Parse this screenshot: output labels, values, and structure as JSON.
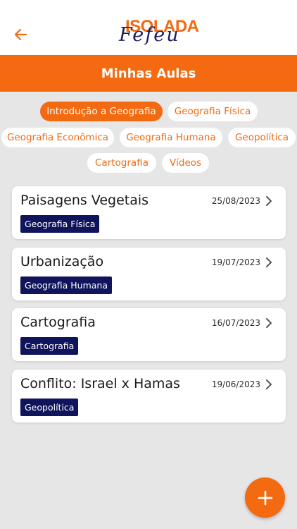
{
  "app": {
    "logo_top": "ISOLADA",
    "logo_script": "Fefeu"
  },
  "header": {
    "title": "Minhas Aulas"
  },
  "filters": [
    {
      "label": "Introdução a Geografia",
      "active": true
    },
    {
      "label": "Geografia Física",
      "active": false
    },
    {
      "label": "Geografia Econômica",
      "active": false
    },
    {
      "label": "Geografia Humana",
      "active": false
    },
    {
      "label": "Geopolítica",
      "active": false
    },
    {
      "label": "Cartografia",
      "active": false
    },
    {
      "label": "Vídeos",
      "active": false
    }
  ],
  "lessons": [
    {
      "title": "Paisagens Vegetais",
      "date": "25/08/2023",
      "tag": "Geografia Física"
    },
    {
      "title": "Urbanização",
      "date": "19/07/2023",
      "tag": "Geografia Humana"
    },
    {
      "title": "Cartografia",
      "date": "16/07/2023",
      "tag": "Cartografia"
    },
    {
      "title": "Conflito: Israel x Hamas",
      "date": "19/06/2023",
      "tag": "Geopolítica"
    }
  ],
  "icons": {
    "back": "arrow-left-icon",
    "chevron": "chevron-right-icon",
    "add": "plus-icon"
  },
  "colors": {
    "accent": "#f36a10",
    "tag_background": "#10145c",
    "page_background": "#e6e6e6"
  }
}
